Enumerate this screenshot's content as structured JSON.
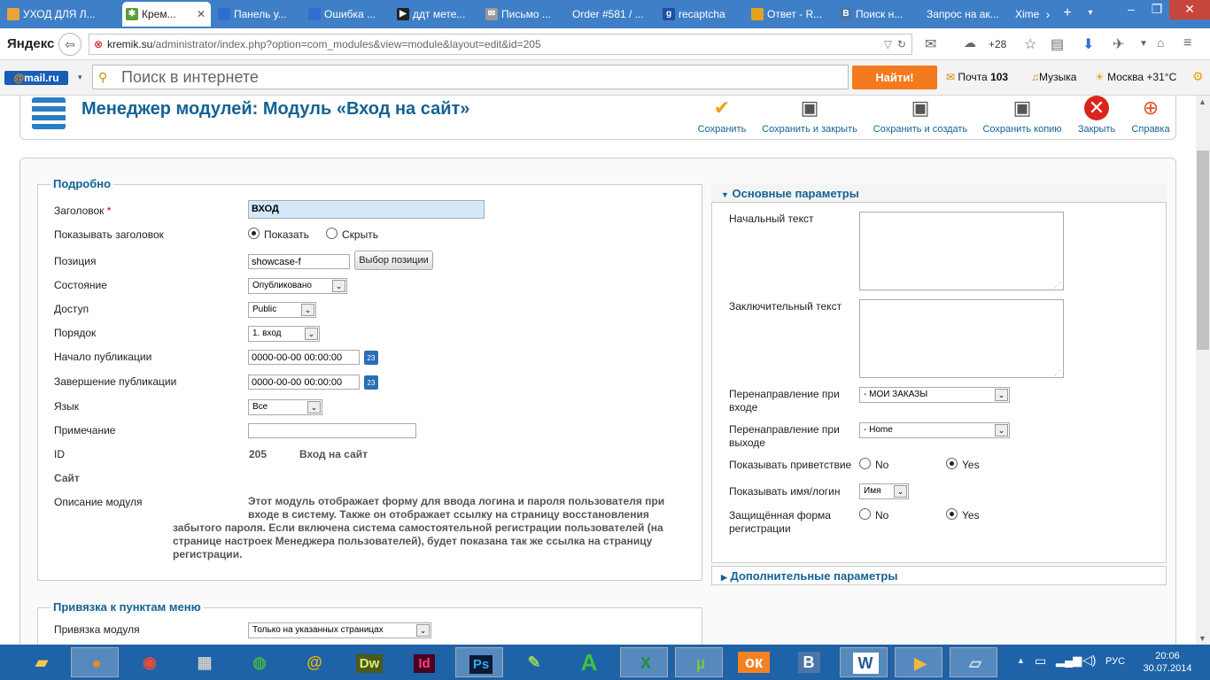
{
  "browser": {
    "tabs": [
      {
        "label": "УХОД ДЛЯ Л..."
      },
      {
        "label": "Крем...",
        "active": true
      },
      {
        "label": "Панель у..."
      },
      {
        "label": "Ошибка ..."
      },
      {
        "label": "ддт мете..."
      },
      {
        "label": "Письмо ..."
      },
      {
        "label": "Order #581 / ..."
      },
      {
        "label": "recaptcha"
      },
      {
        "label": "Ответ - R..."
      },
      {
        "label": "Поиск н..."
      },
      {
        "label": "Запрос на ак..."
      },
      {
        "label": "Xime"
      }
    ],
    "brand": "Яндекс",
    "url_host": "kremik.su",
    "url_path": "/administrator/index.php?option=com_modules&view=module&layout=edit&id=205",
    "weather": "+28"
  },
  "mailbar": {
    "logo_at": "@",
    "logo_text": "mail.ru",
    "search_placeholder": "Поиск в интернете",
    "find_button": "Найти!",
    "mail_label": "Почта",
    "mail_count": "103",
    "music": "Музыка",
    "city_weather": "Москва +31°С"
  },
  "header": {
    "title": "Менеджер модулей: Модуль «Вход на сайт»",
    "toolbar": {
      "save": "Сохранить",
      "save_close": "Сохранить и закрыть",
      "save_new": "Сохранить и создать",
      "save_copy": "Сохранить копию",
      "close": "Закрыть",
      "help": "Справка"
    }
  },
  "details": {
    "legend": "Подробно",
    "title_label": "Заголовок",
    "title_required": "*",
    "title_value": "ВХОД",
    "show_title_label": "Показывать заголовок",
    "show_option": "Показать",
    "hide_option": "Скрыть",
    "position_label": "Позиция",
    "position_value": "showcase-f",
    "position_button": "Выбор позиции",
    "state_label": "Состояние",
    "state_value": "Опубликовано",
    "access_label": "Доступ",
    "access_value": "Public",
    "order_label": "Порядок",
    "order_value": "1. вход",
    "publish_up_label": "Начало публикации",
    "publish_up_value": "0000-00-00 00:00:00",
    "publish_down_label": "Завершение публикации",
    "publish_down_value": "0000-00-00 00:00:00",
    "calendar_glyph": "23",
    "language_label": "Язык",
    "language_value": "Все",
    "note_label": "Примечание",
    "note_value": "",
    "id_label": "ID",
    "id_value": "205",
    "id_name": "Вход на сайт",
    "site_label": "Сайт",
    "desc_label": "Описание модуля",
    "desc_line1": "Этот модуль отображает форму для ввода логина и пароля пользователя при",
    "desc_line2": "входе в систему. Также он отображает ссылку на страницу восстановления",
    "desc_line3": "забытого пароля. Если включена система самостоятельной регистрации пользователей (на",
    "desc_line4": "странице настроек Менеджера пользователей), будет показана так же ссылка на страницу",
    "desc_line5": "регистрации."
  },
  "basic": {
    "heading": "Основные параметры",
    "pretext_label": "Начальный текст",
    "posttext_label": "Заключительный текст",
    "login_redirect_label_1": "Перенаправление при",
    "login_redirect_label_2": "входе",
    "login_redirect_value": "- МОИ ЗАКАЗЫ",
    "logout_redirect_label_1": "Перенаправление при",
    "logout_redirect_label_2": "выходе",
    "logout_redirect_value": "- Home",
    "greeting_label": "Показывать приветствие",
    "no": "No",
    "yes": "Yes",
    "name_label": "Показывать имя/логин",
    "name_value": "Имя",
    "secure_label_1": "Защищённая форма",
    "secure_label_2": "регистрации"
  },
  "advanced": {
    "heading": "Дополнительные параметры"
  },
  "menu_assignment": {
    "legend": "Привязка к пунктам меню",
    "label": "Привязка модуля",
    "value": "Только на указанных страницах"
  },
  "taskbar": {
    "items": [
      "explorer",
      "firefox",
      "paint",
      "calculator",
      "chrome",
      "mail-agent",
      "Dw",
      "Id",
      "Ps",
      "notepad++",
      "A",
      "excel",
      "utorrent",
      "odnoklassniki",
      "B",
      "word",
      "media",
      "notes"
    ],
    "lang": "РУС",
    "time": "20:06",
    "date": "30.07.2014"
  }
}
